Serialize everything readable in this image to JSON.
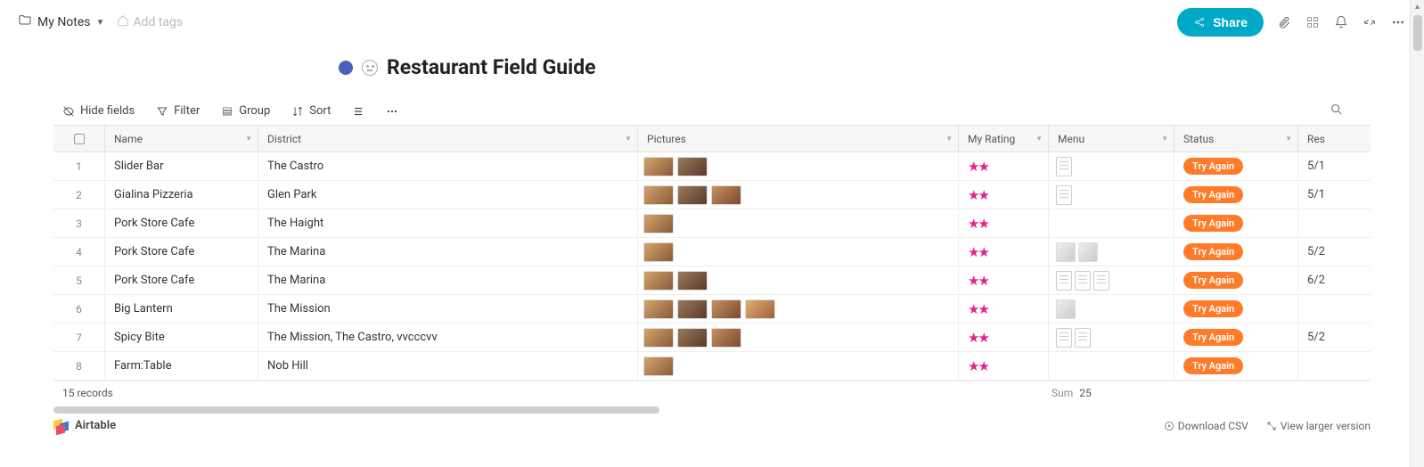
{
  "breadcrumb": {
    "label": "My Notes"
  },
  "add_tags": "Add tags",
  "share_label": "Share",
  "page_title": "Restaurant Field Guide",
  "toolbar": {
    "hide_fields": "Hide fields",
    "filter": "Filter",
    "group": "Group",
    "sort": "Sort"
  },
  "columns": {
    "name": "Name",
    "district": "District",
    "pictures": "Pictures",
    "rating": "My Rating",
    "menu": "Menu",
    "status": "Status",
    "res": "Res"
  },
  "rows": [
    {
      "idx": "1",
      "name": "Slider Bar",
      "district": "The Castro",
      "pics": 2,
      "rating": "★★",
      "menu_docs": 1,
      "status": "Try Again",
      "res": "5/1"
    },
    {
      "idx": "2",
      "name": "Gialina Pizzeria",
      "district": "Glen Park",
      "pics": 3,
      "rating": "★★",
      "menu_docs": 1,
      "status": "Try Again",
      "res": "5/1"
    },
    {
      "idx": "3",
      "name": "Pork Store Cafe",
      "district": "The Haight",
      "pics": 1,
      "rating": "★★",
      "menu_docs": 0,
      "status": "Try Again",
      "res": ""
    },
    {
      "idx": "4",
      "name": "Pork Store Cafe",
      "district": "The Marina",
      "pics": 1,
      "rating": "★★",
      "menu_docs": 0,
      "menu_thumbs": 2,
      "status": "Try Again",
      "res": "5/2"
    },
    {
      "idx": "5",
      "name": "Pork Store Cafe",
      "district": "The Marina",
      "pics": 2,
      "rating": "★★",
      "menu_docs": 3,
      "status": "Try Again",
      "res": "6/2"
    },
    {
      "idx": "6",
      "name": "Big Lantern",
      "district": "The Mission",
      "pics": 4,
      "rating": "★★",
      "menu_docs": 0,
      "menu_thumbs": 1,
      "status": "Try Again",
      "res": ""
    },
    {
      "idx": "7",
      "name": "Spicy Bite",
      "district": "The Mission, The Castro, vvcccvv",
      "pics": 3,
      "rating": "★★",
      "menu_docs": 2,
      "status": "Try Again",
      "res": "5/2"
    },
    {
      "idx": "8",
      "name": "Farm:Table",
      "district": "Nob Hill",
      "pics": 1,
      "rating": "★★",
      "menu_docs": 0,
      "status": "Try Again",
      "res": ""
    }
  ],
  "footer": {
    "records": "15 records",
    "sum_label": "Sum",
    "sum_value": "25"
  },
  "bottom": {
    "brand": "Airtable",
    "download": "Download CSV",
    "view_larger": "View larger version"
  }
}
